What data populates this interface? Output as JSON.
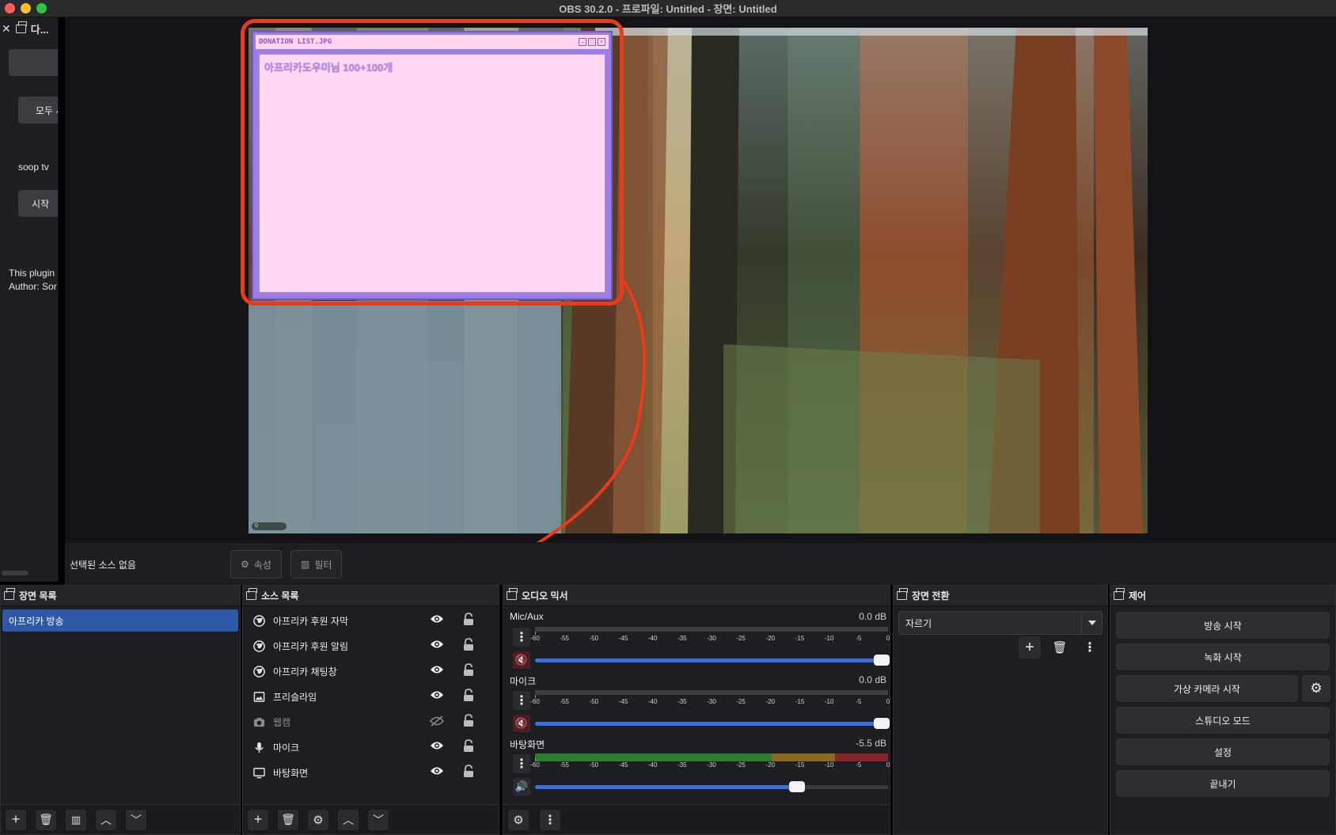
{
  "window": {
    "title": "OBS 30.2.0 - 프로파일: Untitled - 장면: Untitled"
  },
  "left_dock": {
    "title": "다...",
    "button_all": "모두 시",
    "label_soop": "soop tv",
    "button_start": "시작",
    "plugin_line1": "This plugin",
    "plugin_line2": "Author: Sor"
  },
  "preview": {
    "donation_window_title": "DONATION LIST.JPG",
    "donation_text": "아프리카도우미님 100+100개",
    "haze_badge": "0"
  },
  "source_toolbar": {
    "no_source": "선택된 소스 없음",
    "properties": "속성",
    "filters": "필터"
  },
  "scenes": {
    "title": "장면 목록",
    "items": [
      "아프리카 방송"
    ]
  },
  "sources": {
    "title": "소스 목록",
    "items": [
      {
        "label": "아프리카 후원 자막",
        "icon": "globe-icon",
        "visible": true
      },
      {
        "label": "아프리카 후원 알림",
        "icon": "globe-icon",
        "visible": true
      },
      {
        "label": "아프리카 채팅창",
        "icon": "globe-icon",
        "visible": true
      },
      {
        "label": "프리슬라임",
        "icon": "image-icon",
        "visible": true
      },
      {
        "label": "웹캠",
        "icon": "camera-icon",
        "visible": false
      },
      {
        "label": "마이크",
        "icon": "microphone-icon",
        "visible": true
      },
      {
        "label": "바탕화면",
        "icon": "monitor-icon",
        "visible": true
      }
    ]
  },
  "audio_mixer": {
    "title": "오디오 믹서",
    "scale": [
      "-60",
      "-55",
      "-50",
      "-45",
      "-40",
      "-35",
      "-30",
      "-25",
      "-20",
      "-15",
      "-10",
      "-5",
      "0"
    ],
    "channels": [
      {
        "name": "Mic/Aux",
        "db": "0.0 dB",
        "muted": true,
        "volume": 1.0,
        "level": 0.0
      },
      {
        "name": "마이크",
        "db": "0.0 dB",
        "muted": true,
        "volume": 1.0,
        "level": 0.0
      },
      {
        "name": "바탕화면",
        "db": "-5.5 dB",
        "muted": false,
        "volume": 0.76,
        "level": 1.0
      }
    ]
  },
  "transitions": {
    "title": "장면 전환",
    "selected": "자르기"
  },
  "controls": {
    "title": "제어",
    "start_streaming": "방송 시작",
    "start_recording": "녹화 시작",
    "start_virtual_camera": "가상 카메라 시작",
    "studio_mode": "스튜디오 모드",
    "settings": "설정",
    "exit": "끝내기"
  },
  "colors": {
    "accent": "#2d5aa8",
    "annotation": "#ea3a1c",
    "volume": "#3f6ee3"
  }
}
